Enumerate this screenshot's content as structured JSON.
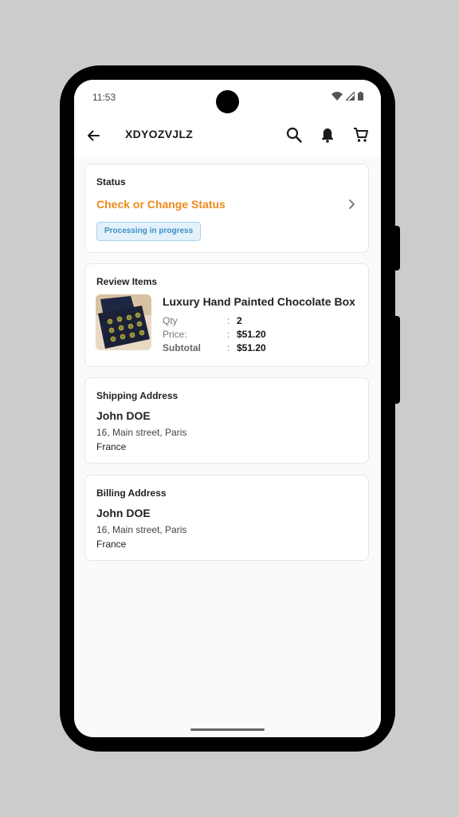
{
  "statusbar": {
    "time": "11:53"
  },
  "appbar": {
    "title": "XDYOZVJLZ",
    "icons": [
      "back-arrow-icon",
      "search-icon",
      "bell-icon",
      "cart-icon"
    ]
  },
  "status_card": {
    "label": "Status",
    "link": "Check or Change Status",
    "badge": "Processing in progress"
  },
  "review_card": {
    "label": "Review Items",
    "item": {
      "name": "Luxury Hand Painted Chocolate Box",
      "qty_label": "Qty",
      "qty": "2",
      "price_label": "Price:",
      "price": "$51.20",
      "subtotal_label": "Subtotal",
      "subtotal": "$51.20",
      "separator": ":"
    }
  },
  "shipping_card": {
    "label": "Shipping Address",
    "name": "John DOE",
    "street": "16, Main street, Paris",
    "country": "France"
  },
  "billing_card": {
    "label": "Billing Address",
    "name": "John DOE",
    "street": "16, Main street, Paris",
    "country": "France"
  },
  "colors": {
    "accent": "#ec8a1f",
    "badge_text": "#3b8fc6",
    "badge_bg": "#e3f1fb"
  }
}
